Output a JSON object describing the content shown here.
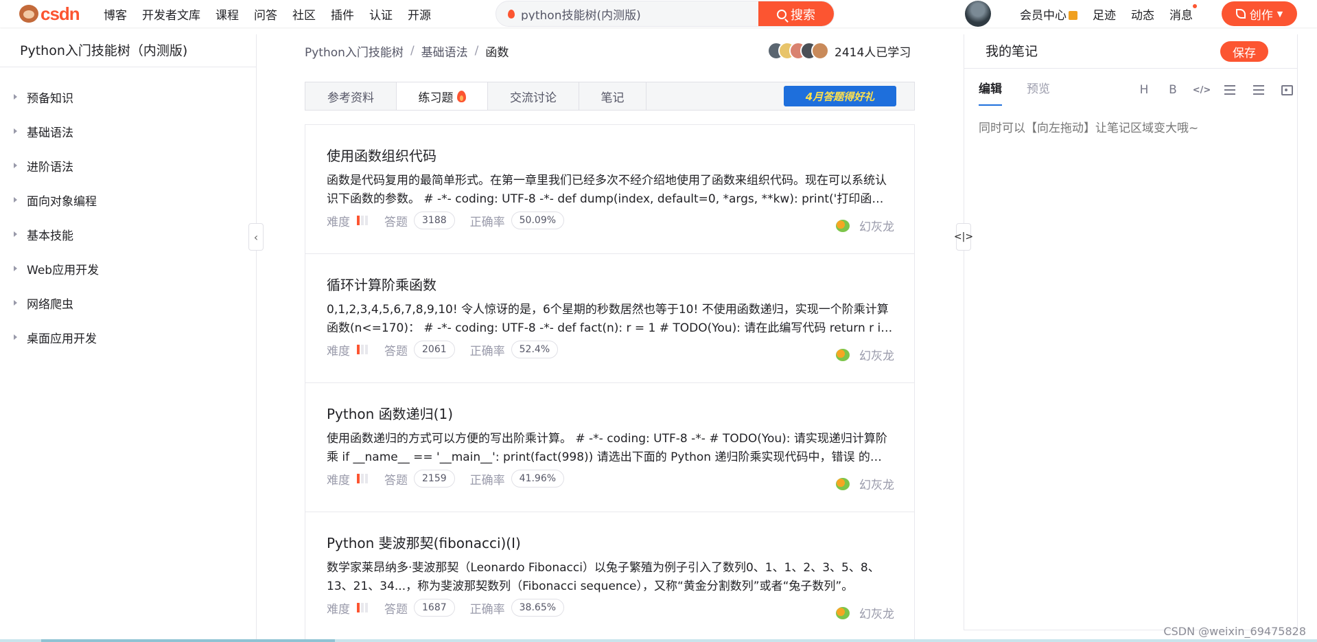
{
  "header": {
    "logo_text": "csdn",
    "nav": [
      "博客",
      "开发者文库",
      "课程",
      "问答",
      "社区",
      "插件",
      "认证",
      "开源"
    ],
    "search": {
      "value": "python技能树(内测版)",
      "button": "搜索"
    },
    "right_nav": {
      "vip": "会员中心",
      "footprint": "足迹",
      "dynamic": "动态",
      "messages": "消息"
    },
    "create": "创作",
    "colors": {
      "brand": "#fc5531",
      "promo": "#1e6fdc"
    }
  },
  "sidebar": {
    "title": "Python入门技能树（内测版)",
    "items": [
      "预备知识",
      "基础语法",
      "进阶语法",
      "面向对象编程",
      "基本技能",
      "Web应用开发",
      "网络爬虫",
      "桌面应用开发"
    ]
  },
  "breadcrumb": {
    "items": [
      "Python入门技能树",
      "基础语法",
      "函数"
    ]
  },
  "learners": {
    "count_text": "2414人已学习"
  },
  "tabs": {
    "items": [
      "参考资料",
      "练习题",
      "交流讨论",
      "笔记"
    ],
    "active": "练习题",
    "promo": "4月答题得好礼"
  },
  "meta_labels": {
    "difficulty": "难度",
    "answers": "答题",
    "accuracy": "正确率"
  },
  "questions": [
    {
      "title": "使用函数组织代码",
      "desc": "函数是代码复用的最简单形式。在第一章里我们已经多次不经介绍地使用了函数来组织代码。现在可以系统认识下函数的参数。 # -*- coding: UTF-8 -*- def dump(index, default=0, *args, **kw): print('打印函数参数')",
      "answers": "3188",
      "accuracy": "50.09%",
      "difficulty_level": 1,
      "author": "幻灰龙"
    },
    {
      "title": "循环计算阶乘函数",
      "desc": "0,1,2,3,4,5,6,7,8,9,10! 令人惊讶的是，6个星期的秒数居然也等于10! 不使用函数递归，实现一个阶乘计算函数(n<=170)：  # -*- coding: UTF-8 -*- def fact(n): r = 1 # TODO(You): 请在此编写代码 return r if __name__",
      "answers": "2061",
      "accuracy": "52.4%",
      "difficulty_level": 1,
      "author": "幻灰龙"
    },
    {
      "title": "Python 函数递归(1)",
      "desc": "使用函数递归的方式可以方便的写出阶乘计算。 # -*- coding: UTF-8 -*- # TODO(You): 请实现递归计算阶乘 if __name__ == '__main__': print(fact(998)) 请选出下面的 Python 递归阶乘实现代码中，错误 的选项",
      "answers": "2159",
      "accuracy": "41.96%",
      "difficulty_level": 1,
      "author": "幻灰龙"
    },
    {
      "title": "Python 斐波那契(fibonacci)(I)",
      "desc": "数学家莱昂纳多·斐波那契（Leonardo Fibonacci）以兔子繁殖为例子引入了数列0、1、1、2、3、5、8、13、21、34...，称为斐波那契数列（Fibonacci sequence），又称“黄金分割数列”或者“兔子数列”。",
      "answers": "1687",
      "accuracy": "38.65%",
      "difficulty_level": 1,
      "author": "幻灰龙"
    }
  ],
  "notes": {
    "title": "我的笔记",
    "save": "保存",
    "tab_edit": "编辑",
    "tab_preview": "预览",
    "toolbar": {
      "heading": "H",
      "bold": "B",
      "code": "</>"
    },
    "placeholder": "同时可以【向左拖动】让笔记区域变大哦~"
  },
  "watermark": "CSDN @weixin_69475828"
}
